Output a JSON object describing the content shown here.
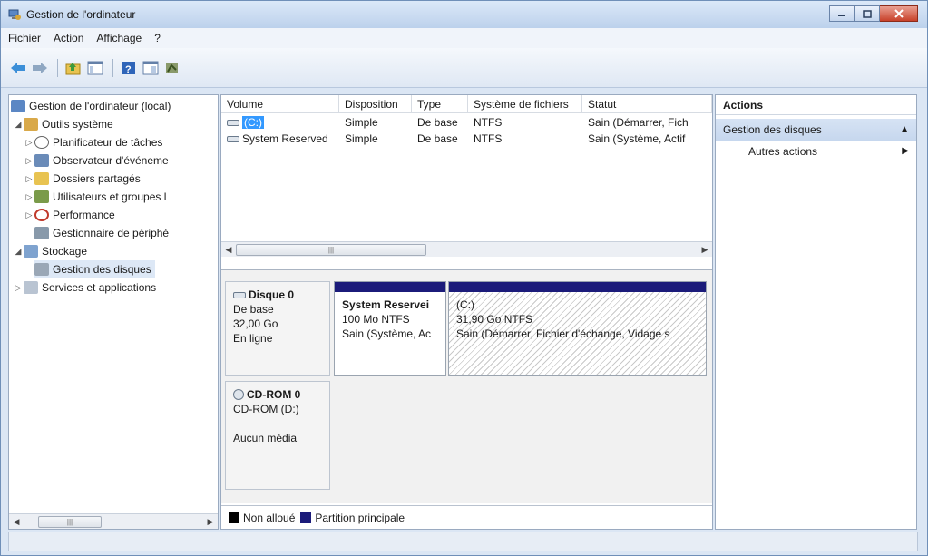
{
  "window": {
    "title": "Gestion de l'ordinateur"
  },
  "menu": [
    "Fichier",
    "Action",
    "Affichage",
    "?"
  ],
  "toolbar": {
    "buttons": [
      "back-arrow-icon",
      "forward-arrow-icon",
      "folder-up-icon",
      "show-hide-tree-icon",
      "help-icon",
      "view-icon",
      "properties-icon"
    ]
  },
  "tree": {
    "root": "Gestion de l'ordinateur (local)",
    "outils": "Outils système",
    "planificateur": "Planificateur de tâches",
    "observateur": "Observateur d'événeme",
    "dossiers": "Dossiers partagés",
    "utilisateurs": "Utilisateurs et groupes l",
    "performance": "Performance",
    "gestionnaire": "Gestionnaire de périphé",
    "stockage": "Stockage",
    "gestion_disques": "Gestion des disques",
    "services": "Services et applications"
  },
  "volumes": {
    "headers": [
      "Volume",
      "Disposition",
      "Type",
      "Système de fichiers",
      "Statut"
    ],
    "rows": [
      {
        "volume": "(C:)",
        "disposition": "Simple",
        "type": "De base",
        "fs": "NTFS",
        "statut": "Sain (Démarrer, Fich"
      },
      {
        "volume": "System Reserved",
        "disposition": "Simple",
        "type": "De base",
        "fs": "NTFS",
        "statut": "Sain (Système, Actif"
      }
    ]
  },
  "disks": {
    "disk0": {
      "name": "Disque 0",
      "kind": "De base",
      "size": "32,00 Go",
      "state": "En ligne"
    },
    "part_reserved": {
      "name": "System Reservei",
      "size": "100 Mo NTFS",
      "status": "Sain (Système, Ac"
    },
    "part_c": {
      "name": "(C:)",
      "size": "31,90 Go NTFS",
      "status": "Sain (Démarrer, Fichier d'échange, Vidage s"
    },
    "cdrom": {
      "name": "CD-ROM 0",
      "drive": "CD-ROM (D:)",
      "media": "Aucun média"
    }
  },
  "legend": {
    "unallocated": "Non alloué",
    "primary": "Partition principale"
  },
  "actions": {
    "header": "Actions",
    "section": "Gestion des disques",
    "more": "Autres actions"
  },
  "colors": {
    "partition_bar": "#1b1b7a",
    "selection": "#3399ff",
    "unallocated": "#000000"
  }
}
